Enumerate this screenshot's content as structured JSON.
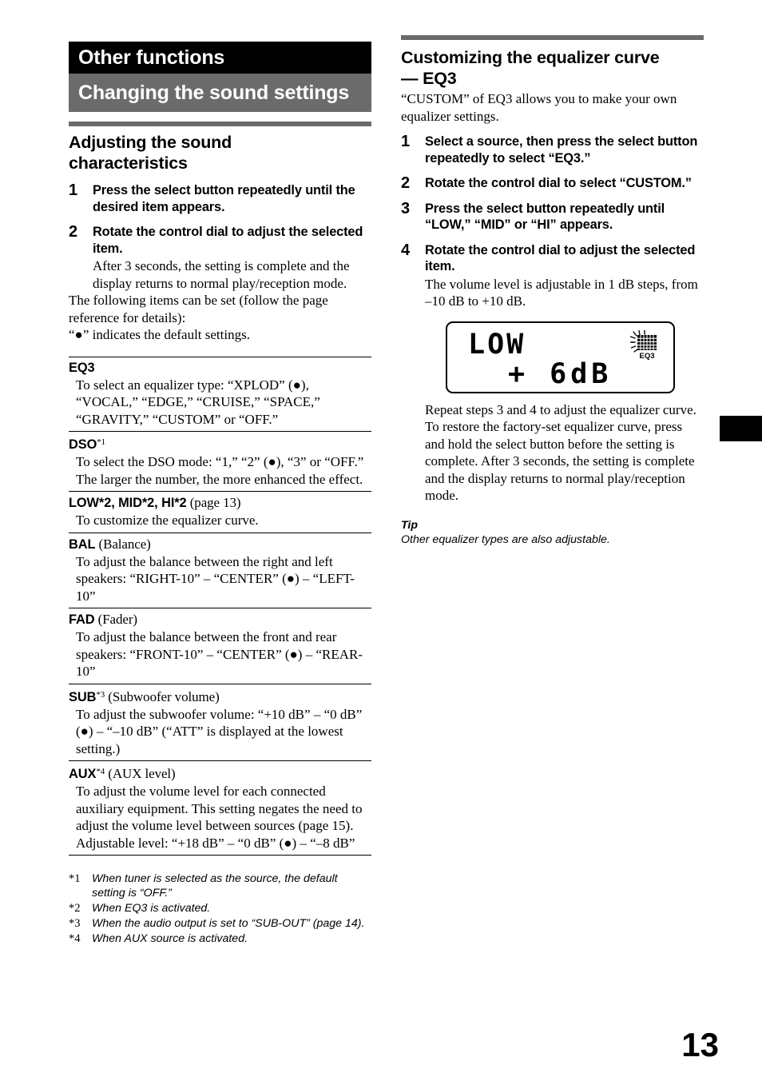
{
  "banner": {
    "chapter": "Other functions",
    "section": "Changing the sound settings"
  },
  "left": {
    "heading_line1": "Adjusting the sound",
    "heading_line2": "characteristics",
    "steps": [
      {
        "num": "1",
        "head": "Press the select button repeatedly until the desired item appears.",
        "body": ""
      },
      {
        "num": "2",
        "head": "Rotate the control dial to adjust the selected item.",
        "body": "After 3 seconds, the setting is complete and the display returns to normal play/reception mode."
      }
    ],
    "intro_paragraph": "The following items can be set (follow the page reference for details):",
    "default_note_pre": "“",
    "default_note_post": "” indicates the default settings.",
    "items": [
      {
        "label": "EQ3",
        "label_sup": "",
        "label_suffix": "",
        "desc": "To select an equalizer type: “XPLOD” (●), “VOCAL,” “EDGE,” “CRUISE,” “SPACE,” “GRAVITY,” “CUSTOM” or “OFF.”"
      },
      {
        "label": "DSO",
        "label_sup": "*1",
        "label_suffix": "",
        "desc": "To select the DSO mode: “1,” “2” (●), “3” or “OFF.” The larger the number, the more enhanced the effect."
      },
      {
        "label": "LOW*2, MID*2, HI*2",
        "label_sup": "",
        "label_suffix": " (page 13)",
        "desc": "To customize the equalizer curve."
      },
      {
        "label": "BAL",
        "label_sup": "",
        "label_suffix": " (Balance)",
        "desc": "To adjust the balance between the right and left speakers: “RIGHT-10” – “CENTER” (●) – “LEFT-10”"
      },
      {
        "label": "FAD",
        "label_sup": "",
        "label_suffix": " (Fader)",
        "desc": "To adjust the balance between the front and rear speakers: “FRONT-10” – “CENTER” (●) – “REAR-10”"
      },
      {
        "label": "SUB",
        "label_sup": "*3",
        "label_suffix": " (Subwoofer volume)",
        "desc": "To adjust the subwoofer volume: “+10 dB” – “0 dB” (●) – “–10 dB” (“ATT” is displayed at the lowest setting.)"
      },
      {
        "label": "AUX",
        "label_sup": "*4",
        "label_suffix": " (AUX level)",
        "desc": "To adjust the volume level for each connected auxiliary equipment. This setting negates the need to adjust the volume level between sources (page 15). Adjustable level: “+18 dB” – “0 dB” (●) – “–8 dB”"
      }
    ],
    "footnotes": [
      {
        "mark": "*1",
        "text": "When tuner is selected as the source, the default setting is “OFF.”"
      },
      {
        "mark": "*2",
        "text": "When EQ3 is activated."
      },
      {
        "mark": "*3",
        "text": "When the audio output is set to “SUB-OUT” (page 14)."
      },
      {
        "mark": "*4",
        "text": "When AUX source is activated."
      }
    ]
  },
  "right": {
    "heading_line1": "Customizing the equalizer curve",
    "heading_line2": "— EQ3",
    "intro": "“CUSTOM” of EQ3 allows you to make your own equalizer settings.",
    "steps": [
      {
        "num": "1",
        "head": "Select a source, then press the select button repeatedly to select “EQ3.”",
        "body": ""
      },
      {
        "num": "2",
        "head": "Rotate the control dial to select “CUSTOM.”",
        "body": ""
      },
      {
        "num": "3",
        "head": "Press the select button repeatedly until “LOW,” “MID” or “HI” appears.",
        "body": ""
      },
      {
        "num": "4",
        "head": "Rotate the control dial to adjust the selected item.",
        "body": "The volume level is adjustable in 1 dB steps, from –10 dB to +10 dB."
      }
    ],
    "lcd": {
      "line1": "LOW",
      "line2": "+ 6dB",
      "indicator_label": "EQ3"
    },
    "after_lcd": "Repeat steps 3 and 4 to adjust the equalizer curve. To restore the factory-set equalizer curve, press and hold the select button before the setting is complete. After 3 seconds, the setting is complete and the display returns to normal play/reception mode.",
    "tip_heading": "Tip",
    "tip_text": "Other equalizer types are also adjustable."
  },
  "folio": "13",
  "colors": {
    "banner_chapter_bg": "#000000",
    "banner_section_bg": "#6b6b6b",
    "rule": "#6b6b6b",
    "text": "#000000"
  }
}
